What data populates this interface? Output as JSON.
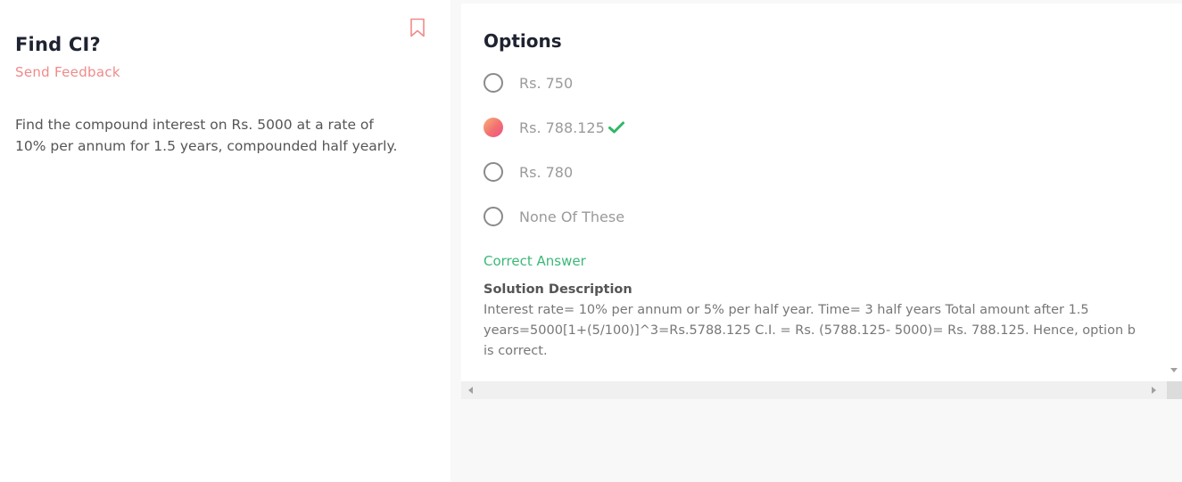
{
  "question": {
    "title": "Find CI?",
    "feedback_label": "Send Feedback",
    "text": "Find the compound interest on Rs. 5000 at a rate of 10% per annum for 1.5 years, compounded half yearly."
  },
  "options_panel": {
    "title": "Options",
    "options": [
      {
        "label": "Rs. 750",
        "selected": false
      },
      {
        "label": "Rs. 788.125",
        "selected": true,
        "correct": true
      },
      {
        "label": "Rs. 780",
        "selected": false
      },
      {
        "label": "None Of These",
        "selected": false
      }
    ],
    "correct_label": "Correct Answer",
    "solution_heading": "Solution Description",
    "solution_text": "Interest rate= 10% per annum or 5% per half year. Time= 3 half years Total amount after 1.5 years=5000[1+(5/100)]^3=Rs.5788.125 C.I. = Rs. (5788.125- 5000)= Rs. 788.125. Hence, option b is correct."
  },
  "icons": {
    "bookmark": "bookmark-icon",
    "check": "check-icon"
  },
  "colors": {
    "accent": "#f08a8a",
    "correct": "#3cb878",
    "check": "#2fb866"
  }
}
